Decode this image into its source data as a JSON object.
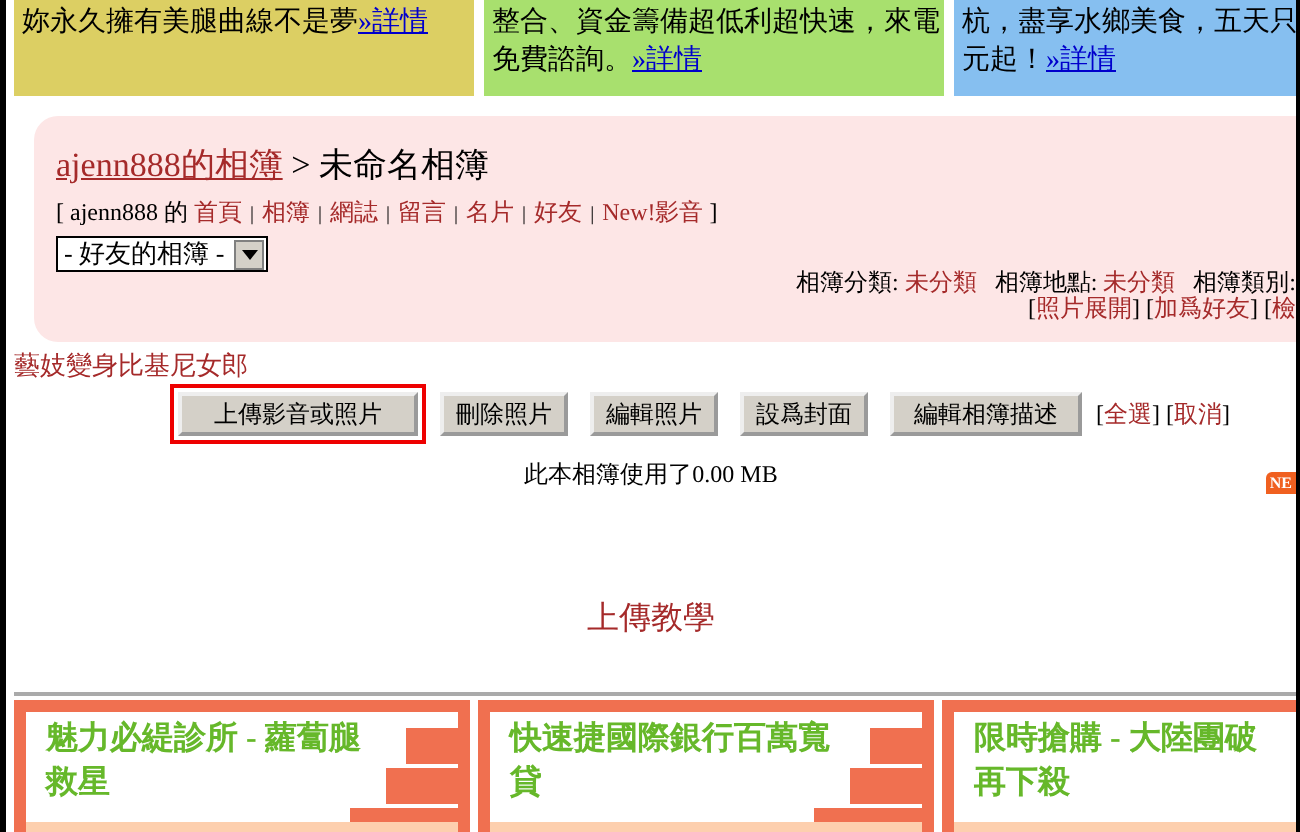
{
  "top_ads": [
    {
      "lines": [
        "妳永久擁有美腿曲線不是夢"
      ],
      "link": "»詳情",
      "color": "#dccf63"
    },
    {
      "lines": [
        "整合、資金籌備超低利超快速，來電",
        "免費諮詢。"
      ],
      "link": "»詳情",
      "color": "#a8e06e"
    },
    {
      "lines": [
        "杭，盡享水鄉美食，五天只",
        "元起！"
      ],
      "link": "»詳情",
      "color": "#86bff0"
    }
  ],
  "album": {
    "owner_link": "ajenn888的相簿",
    "separator": ">",
    "title": "未命名相簿",
    "nav_prefix": "[ ajenn888 的",
    "nav_links": [
      "首頁",
      "相簿",
      "網誌",
      "留言",
      "名片",
      "好友",
      "New!影音"
    ],
    "nav_divider": "|",
    "nav_suffix": "]",
    "dropdown": {
      "value": "- 好友的相簿 -"
    },
    "meta": [
      {
        "label": "相簿分類:",
        "value": "未分類"
      },
      {
        "label": "相簿地點:",
        "value": "未分類"
      },
      {
        "label": "相簿類別:"
      }
    ],
    "actions": [
      {
        "open": "[",
        "text": "照片展開",
        "close": "]"
      },
      {
        "open": "[",
        "text": "加爲好友",
        "close": "]"
      },
      {
        "open": "[",
        "text": "檢"
      }
    ]
  },
  "photo_title": "藝妓變身比基尼女郎",
  "buttons": [
    {
      "label": "上傳影音或照片",
      "highlighted": true
    },
    {
      "label": "刪除照片",
      "highlighted": false
    },
    {
      "label": "編輯照片",
      "highlighted": false
    },
    {
      "label": "設爲封面",
      "highlighted": false
    },
    {
      "label": "編輯相簿描述",
      "highlighted": false
    }
  ],
  "select_links": [
    {
      "open": "[",
      "text": "全選",
      "close": "]"
    },
    {
      "open": "[",
      "text": "取消",
      "close": "]"
    }
  ],
  "usage": "此本相簿使用了0.00 MB",
  "new_badge": "NE",
  "tutorial_link": "上傳教學",
  "bottom_ads": [
    {
      "lines": [
        "魅力必緹診所 - 蘿蔔腿",
        "救星"
      ],
      "icon": true
    },
    {
      "lines": [
        "快速捷國際銀行百萬寬",
        "貸"
      ],
      "icon": true
    },
    {
      "lines": [
        "限時搶購 - 大陸團破",
        "再下殺"
      ],
      "icon": false
    }
  ]
}
